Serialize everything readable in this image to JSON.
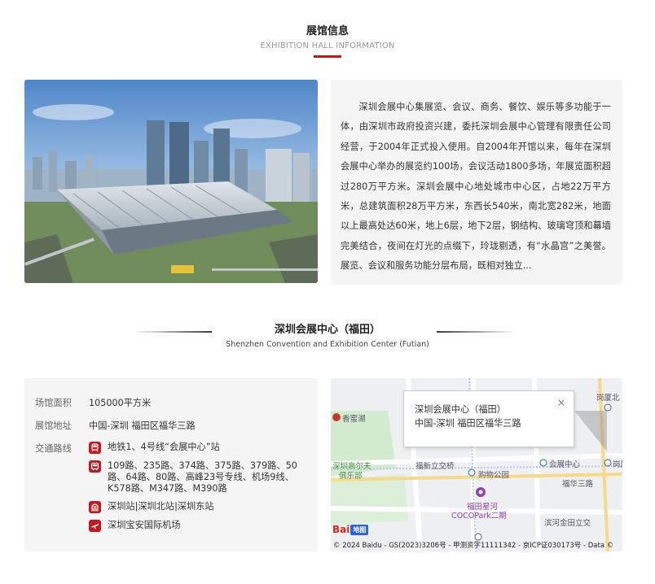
{
  "section": {
    "title": "展馆信息",
    "subtitle": "EXHIBITION HALL INFORMATION"
  },
  "description": "深圳会展中心集展览、会议、商务、餐饮、娱乐等多功能于一体，由深圳市政府投资兴建，委托深圳会展中心管理有限责任公司经营，于2004年正式投入使用。自2004年开馆以来，每年在深圳会展中心举办的展览约100场，会议活动1800多场，年展览面积超过280万平方米。深圳会展中心地处城市中心区，占地22万平方米，总建筑面积28万平方米，东西长540米，南北宽282米，地面以上最高处达60米，地上6层，地下2层，钢结构、玻璃穹顶和幕墙完美结合，夜间在灯光的点缀下，玲珑剔透，有“水晶宫”之美誉。展览、会议和服务功能分层布局，既相对独立...",
  "venue": {
    "name": "深圳会展中心（福田）",
    "name_en": "Shenzhen Convention and Exhibition Center (Futian)",
    "area_label": "场馆面积",
    "area_value": "105000平方米",
    "address_label": "展馆地址",
    "address_value": "中国-深圳 福田区福华三路",
    "transport_label": "交通路线",
    "routes": [
      {
        "icon": "metro-icon",
        "text": "地铁1、4号线“会展中心”站"
      },
      {
        "icon": "bus-icon",
        "text": "109路、235路、374路、375路、379路、50路、64路、80路、高峰23号专线、机场9线、K578路、M347路、M390路"
      },
      {
        "icon": "train-icon",
        "text": "深圳站|深圳北站|深圳东站"
      },
      {
        "icon": "airport-icon",
        "text": "深圳宝安国际机场"
      }
    ]
  },
  "map": {
    "popup_title": "深圳会展中心（福田）",
    "popup_address": "中国-深圳 福田区福华三路",
    "close": "×",
    "labels": {
      "l1": "香蜜湖",
      "l2": "深圳高尔夫",
      "l3": "俱乐部",
      "l4": "福新立交桥",
      "l5": "购物公园",
      "l6": "会展中心",
      "l7": "福华三路",
      "l8": "福田星河",
      "l9": "COCOPark二期",
      "l10": "滨河金田立交",
      "l11": "岗厦北",
      "l12": "岗厦"
    },
    "baidu_text": "Bai",
    "baidu_badge": "地图",
    "copyright": "© 2024 Baidu - GS(2023)3206号 - 甲测资字11111342 - 京ICP证030173号 - Data ©"
  },
  "colors": {
    "accent": "#c8161d",
    "card_bg": "#f5f5f5"
  }
}
